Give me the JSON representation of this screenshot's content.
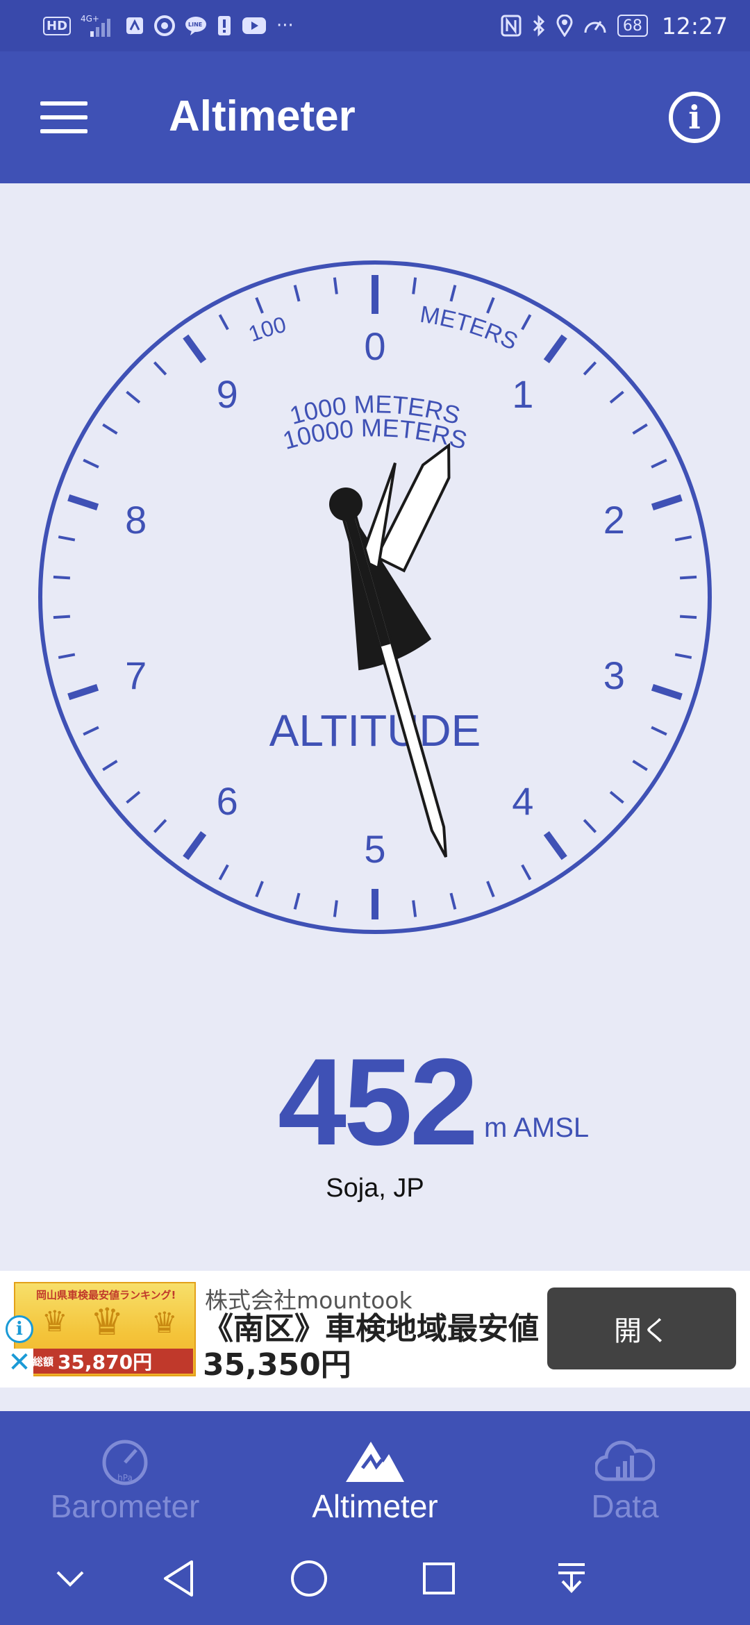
{
  "status_bar": {
    "left_icons": [
      "hd-icon",
      "signal-4g-icon",
      "app-icon",
      "chrome-icon",
      "line-icon",
      "alert-icon",
      "youtube-icon",
      "more-icon"
    ],
    "hd_label": "HD",
    "network_label": "4G+",
    "line_label": "LINE",
    "more_label": "···",
    "battery_level": "68",
    "time": "12:27"
  },
  "app_bar": {
    "title": "Altimeter",
    "info_label": "i"
  },
  "dial": {
    "numerals": [
      "0",
      "1",
      "2",
      "3",
      "4",
      "5",
      "6",
      "7",
      "8",
      "9"
    ],
    "label_hundred": "100",
    "label_meters": "METERS",
    "label_thousand": "1000 METERS",
    "label_ten_thousand": "10000 METERS",
    "label_altitude": "ALTITUDE",
    "color": "#3f51b5",
    "reading_meters": 452
  },
  "readout": {
    "value": "452",
    "unit": "m AMSL",
    "location": "Soja, JP"
  },
  "ad": {
    "image_title": "岡山県車検最安値ランキング!",
    "image_price_prefix": "検総額",
    "image_price": "35,870円",
    "advertiser": "株式会社mountook",
    "headline": "《南区》車検地域最安値35,350円",
    "cta": "開く",
    "info_icon_label": "i",
    "close_icon_label": "✕"
  },
  "bottom_nav": {
    "items": [
      {
        "label": "Barometer",
        "icon": "gauge-icon",
        "active": false
      },
      {
        "label": "Altimeter",
        "icon": "mountain-icon",
        "active": true
      },
      {
        "label": "Data",
        "icon": "cloud-chart-icon",
        "active": false
      }
    ],
    "gauge_icon_unit": "hPa"
  },
  "system_nav": {
    "buttons": [
      "collapse-icon",
      "back-icon",
      "home-icon",
      "recents-icon",
      "notification-pull-icon"
    ]
  },
  "colors": {
    "primary": "#3f51b5",
    "background": "#e8eaf6",
    "status_bar": "#3949ab",
    "ad_button": "#424242"
  }
}
